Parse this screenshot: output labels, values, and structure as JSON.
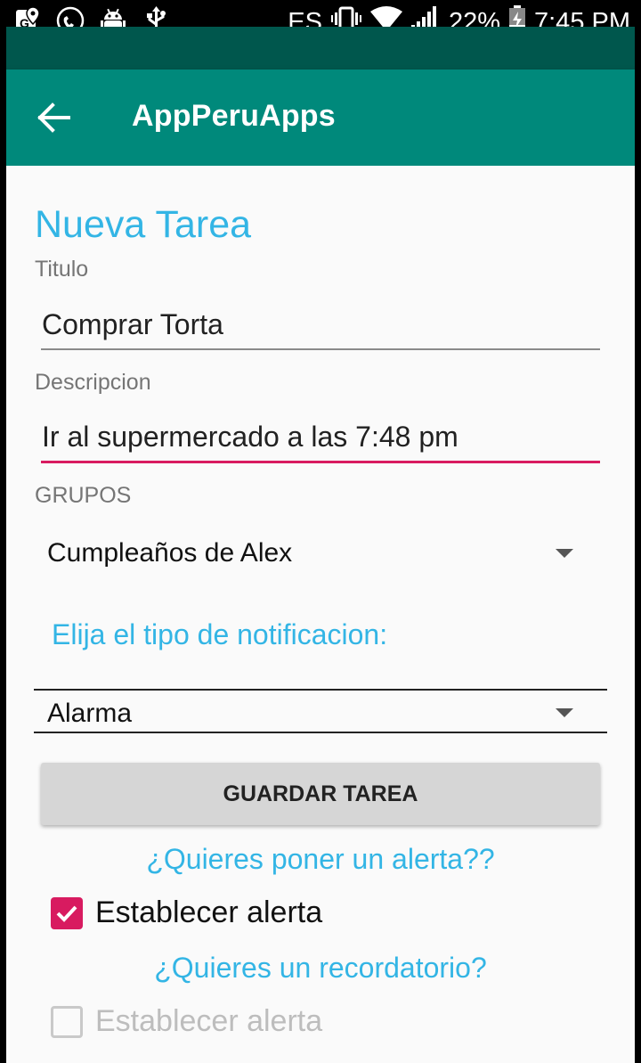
{
  "status_bar": {
    "language": "ES",
    "battery": "22%",
    "time": "7:45 PM"
  },
  "app_bar": {
    "title": "AppPeruApps",
    "back_icon": "arrow-back-icon"
  },
  "form": {
    "heading": "Nueva Tarea",
    "title_label": "Titulo",
    "title_value": "Comprar Torta",
    "description_label": "Descripcion",
    "description_value": "Ir al supermercado a las 7:48 pm",
    "groups_label": "GRUPOS",
    "group_selected": "Cumpleaños de Alex",
    "notification_prompt": "Elija el tipo de notificacion:",
    "notification_selected": "Alarma",
    "save_button": "GUARDAR TAREA",
    "alert_prompt": "¿Quieres poner un alerta??",
    "alert_checkbox_label": "Establecer alerta",
    "alert_checked": true,
    "reminder_prompt": "¿Quieres un recordatorio?",
    "reminder_checkbox_label": "Establecer alerta",
    "reminder_checked": false
  },
  "colors": {
    "accent": "#33b5e5",
    "primary": "#00897b",
    "primary_dark": "#00574d",
    "focus": "#d81b60"
  }
}
